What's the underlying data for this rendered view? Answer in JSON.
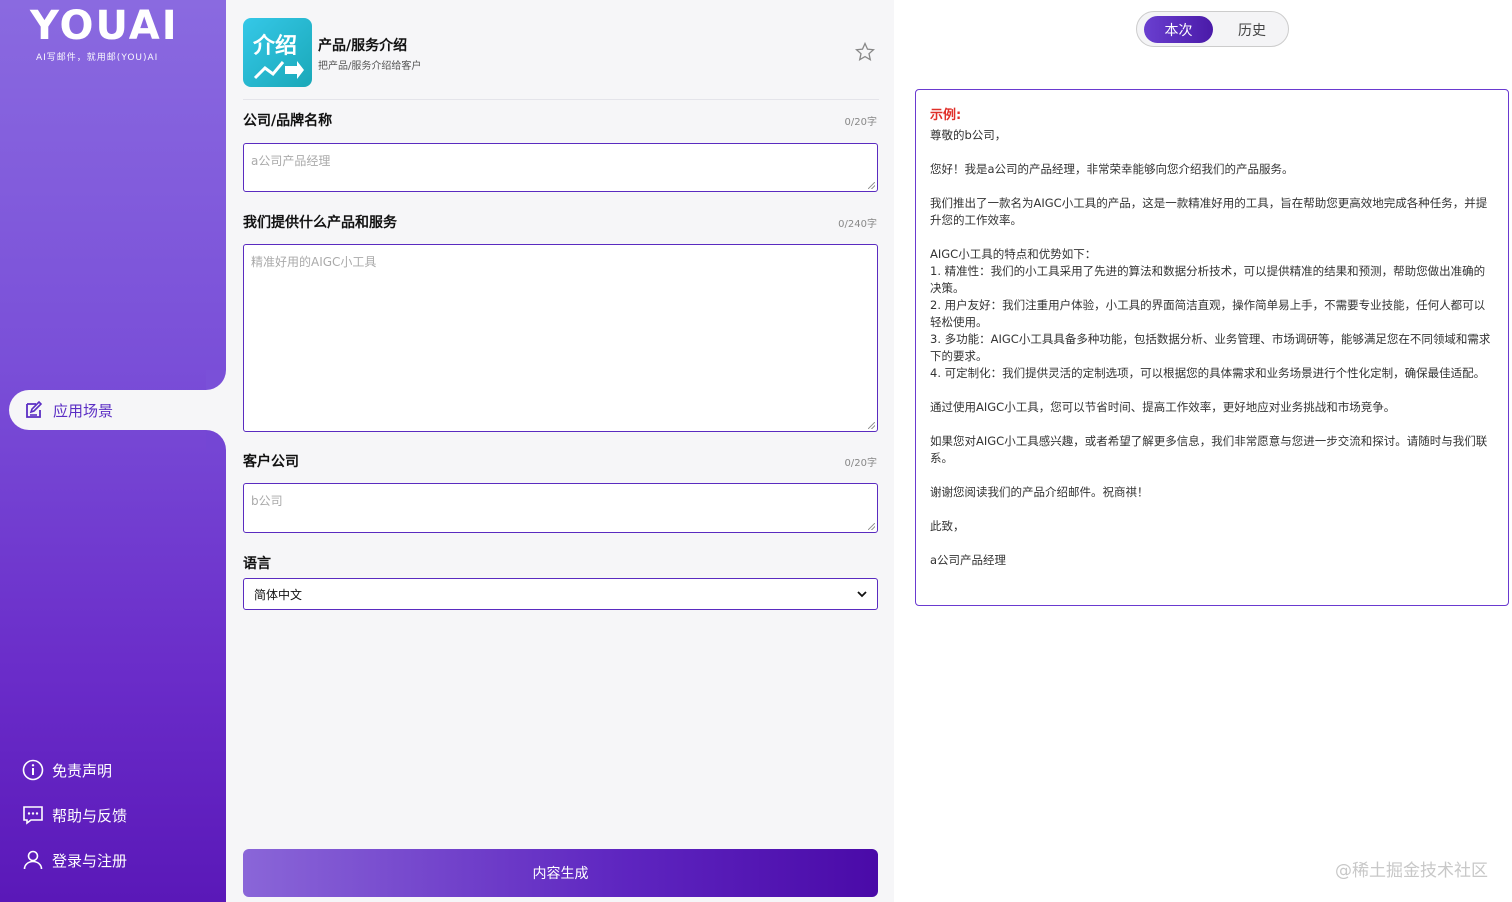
{
  "sidebar": {
    "logo_main": "YOUAI",
    "logo_sub": "AI写邮件，就用邮(YOU)AI",
    "active_item": "应用场景",
    "bottom_items": [
      {
        "label": "免责声明",
        "icon": "info-icon"
      },
      {
        "label": "帮助与反馈",
        "icon": "chat-icon"
      },
      {
        "label": "登录与注册",
        "icon": "user-icon"
      }
    ]
  },
  "app": {
    "icon_text": "介绍",
    "title": "产品/服务介绍",
    "subtitle": "把产品/服务介绍给客户"
  },
  "form": {
    "company": {
      "label": "公司/品牌名称",
      "count": "0/20字",
      "placeholder": "a公司产品经理"
    },
    "product": {
      "label": "我们提供什么产品和服务",
      "count": "0/240字",
      "placeholder": "精准好用的AIGC小工具"
    },
    "client": {
      "label": "客户公司",
      "count": "0/20字",
      "placeholder": "b公司"
    },
    "language": {
      "label": "语言",
      "value": "简体中文"
    },
    "generate_label": "内容生成"
  },
  "toggle": {
    "current": "本次",
    "history": "历史"
  },
  "example": {
    "title": "示例:",
    "lines": [
      "尊敬的b公司，",
      "",
      "您好！我是a公司的产品经理，非常荣幸能够向您介绍我们的产品服务。",
      "",
      "我们推出了一款名为AIGC小工具的产品，这是一款精准好用的工具，旨在帮助您更高效地完成各种任务，并提升您的工作效率。",
      "",
      "AIGC小工具的特点和优势如下：",
      "1. 精准性：我们的小工具采用了先进的算法和数据分析技术，可以提供精准的结果和预测，帮助您做出准确的决策。",
      "2. 用户友好：我们注重用户体验，小工具的界面简洁直观，操作简单易上手，不需要专业技能，任何人都可以轻松使用。",
      "3. 多功能：AIGC小工具具备多种功能，包括数据分析、业务管理、市场调研等，能够满足您在不同领域和需求下的要求。",
      "4. 可定制化：我们提供灵活的定制选项，可以根据您的具体需求和业务场景进行个性化定制，确保最佳适配。",
      "",
      "通过使用AIGC小工具，您可以节省时间、提高工作效率，更好地应对业务挑战和市场竞争。",
      "",
      "如果您对AIGC小工具感兴趣，或者希望了解更多信息，我们非常愿意与您进一步交流和探讨。请随时与我们联系。",
      "",
      "谢谢您阅读我们的产品介绍邮件。祝商祺！",
      "",
      "此致，",
      "",
      "a公司产品经理"
    ]
  },
  "watermark": "@稀土掘金技术社区",
  "colors": {
    "accent": "#5a2bc0",
    "example_title": "#e0302a"
  }
}
